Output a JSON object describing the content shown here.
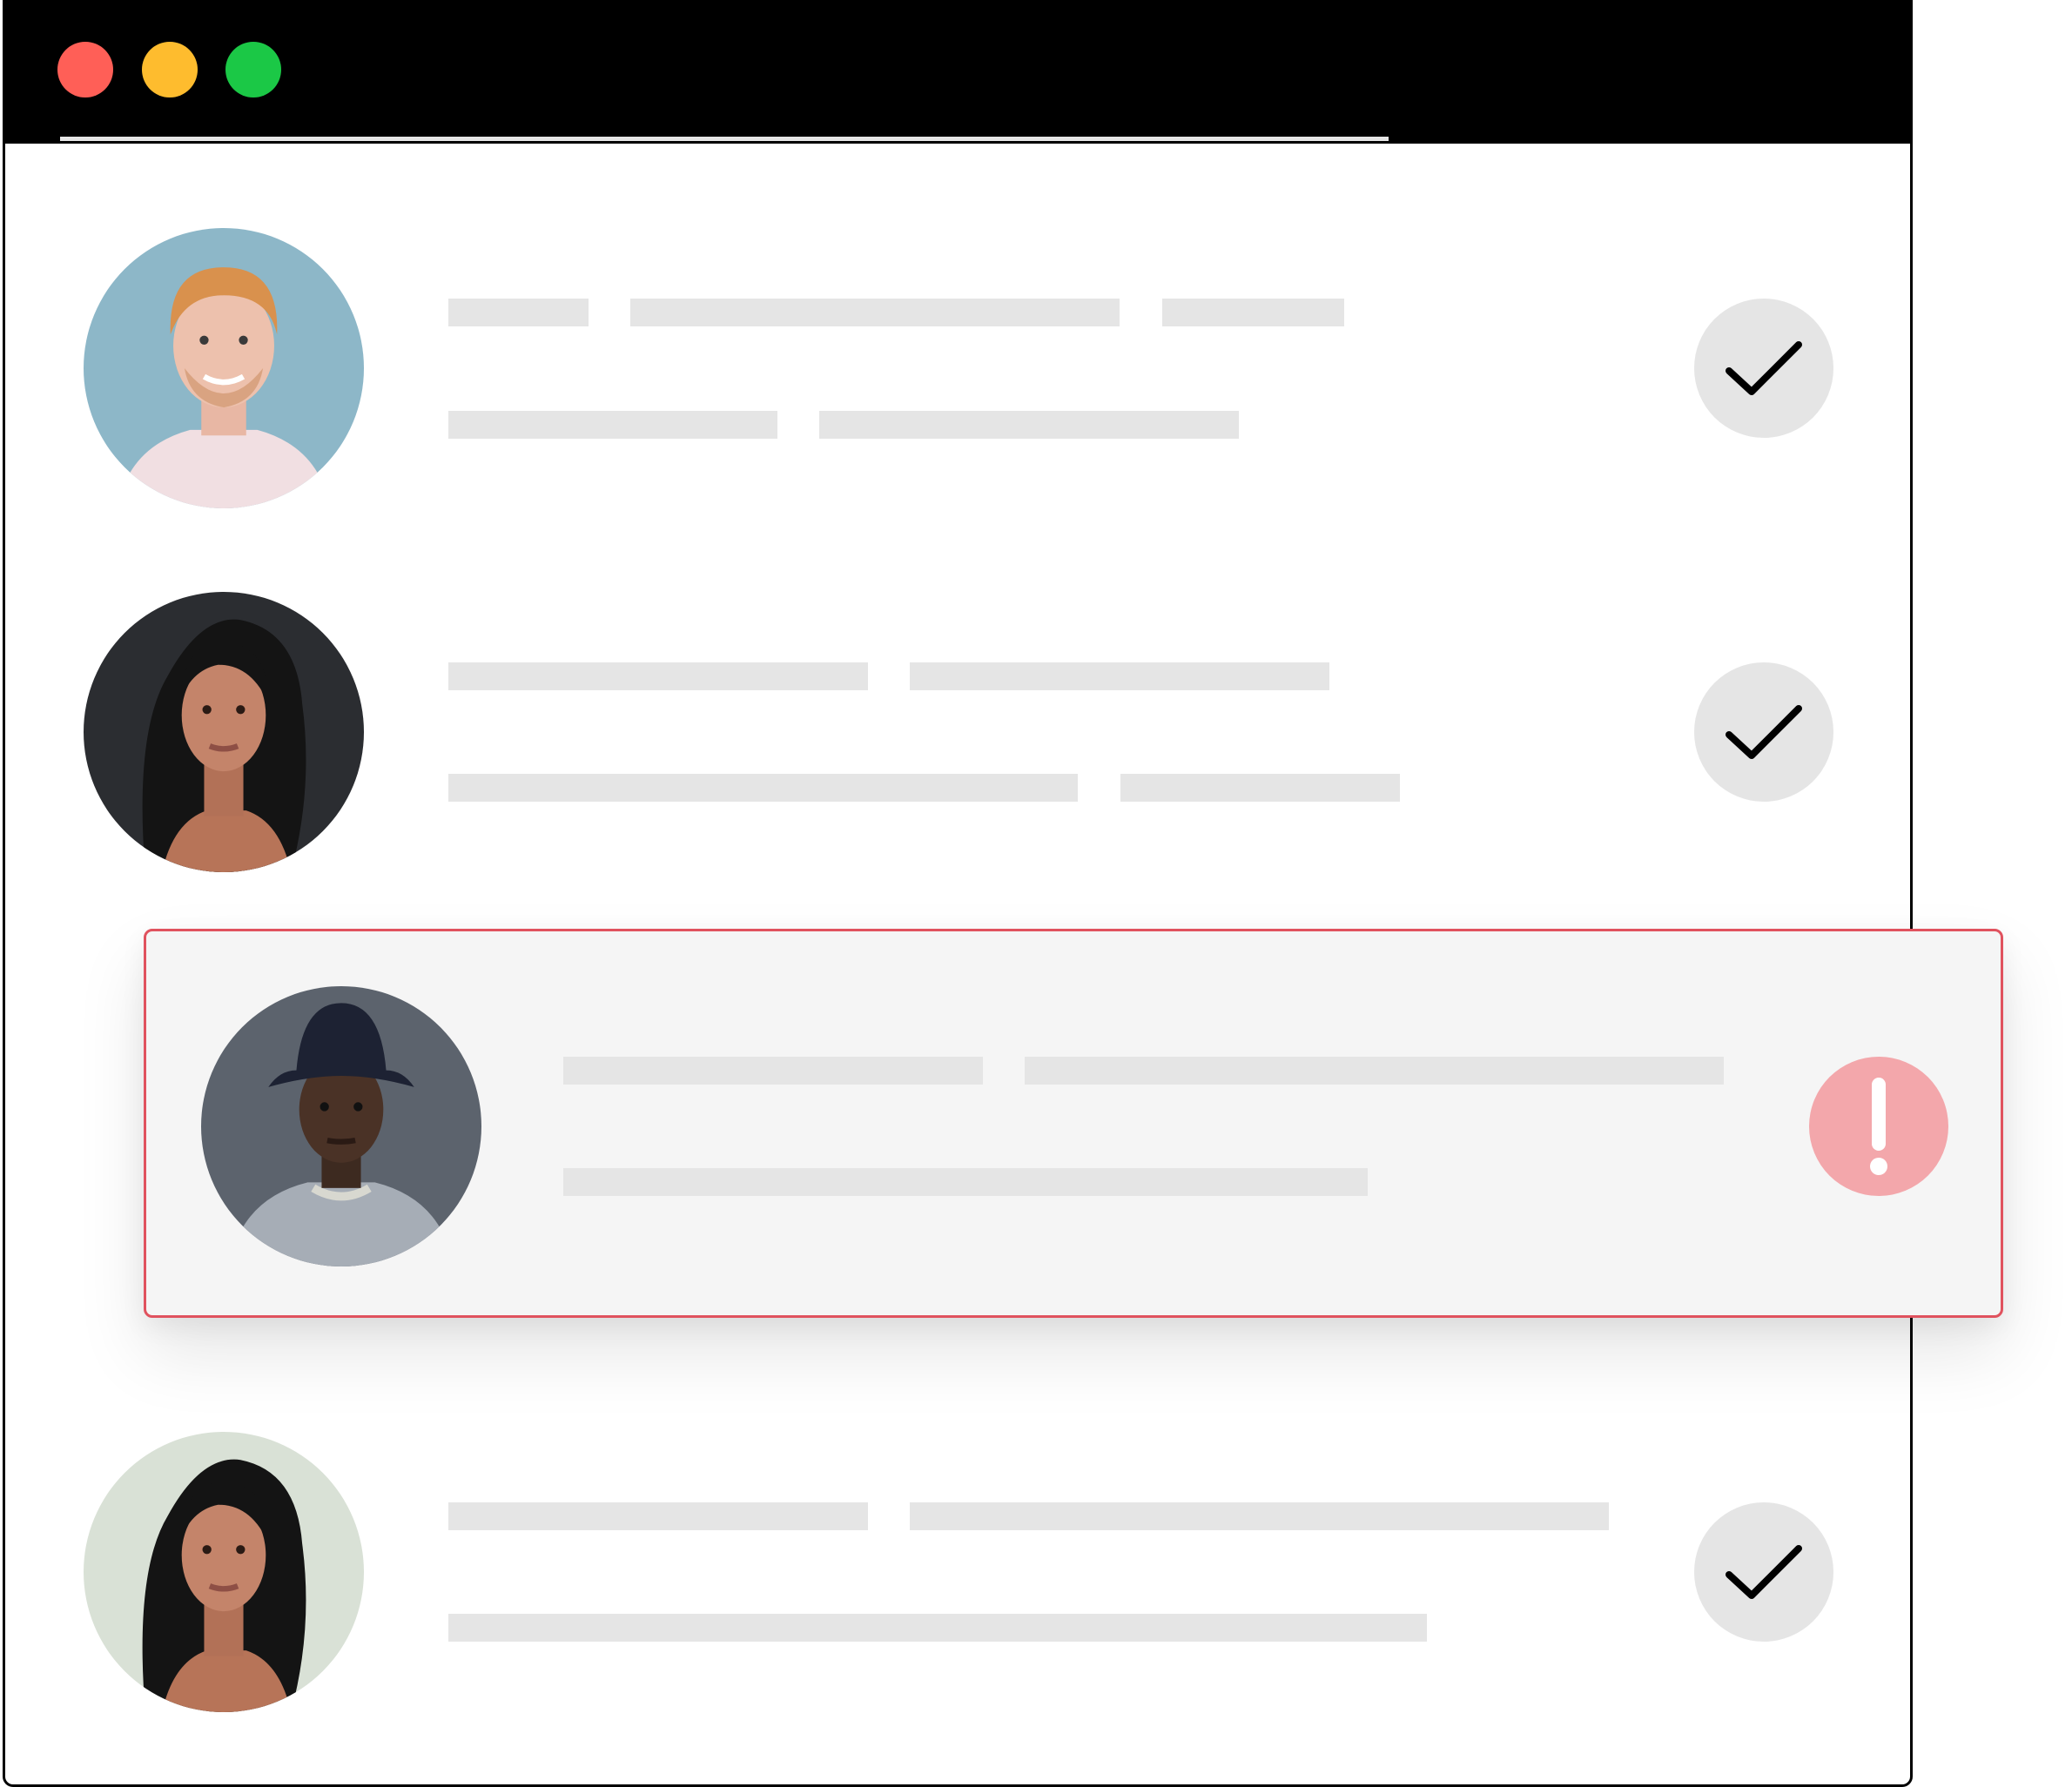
{
  "window": {
    "titlebar_color": "#000000",
    "traffic_lights": [
      {
        "name": "close",
        "color": "#ff5f57"
      },
      {
        "name": "minimize",
        "color": "#febc2e"
      },
      {
        "name": "maximize",
        "color": "#1bc846"
      }
    ]
  },
  "list": {
    "items": [
      {
        "avatar": "person-red-hair-avatar",
        "status": "ok",
        "status_icon": "checkmark-icon"
      },
      {
        "avatar": "person-dark-hair-avatar",
        "status": "ok",
        "status_icon": "checkmark-icon"
      },
      {
        "avatar": "person-bucket-hat-avatar",
        "status": "error",
        "status_icon": "exclamation-icon",
        "highlighted": true
      },
      {
        "avatar": "person-dark-hair-light-bg-avatar",
        "status": "ok",
        "status_icon": "checkmark-icon"
      }
    ]
  },
  "colors": {
    "placeholder_bar": "#e5e5e5",
    "ok_badge": "#e5e5e5",
    "error_badge": "#f3a7ab",
    "error_border": "#e0525e",
    "highlight_bg": "#f5f5f5"
  }
}
